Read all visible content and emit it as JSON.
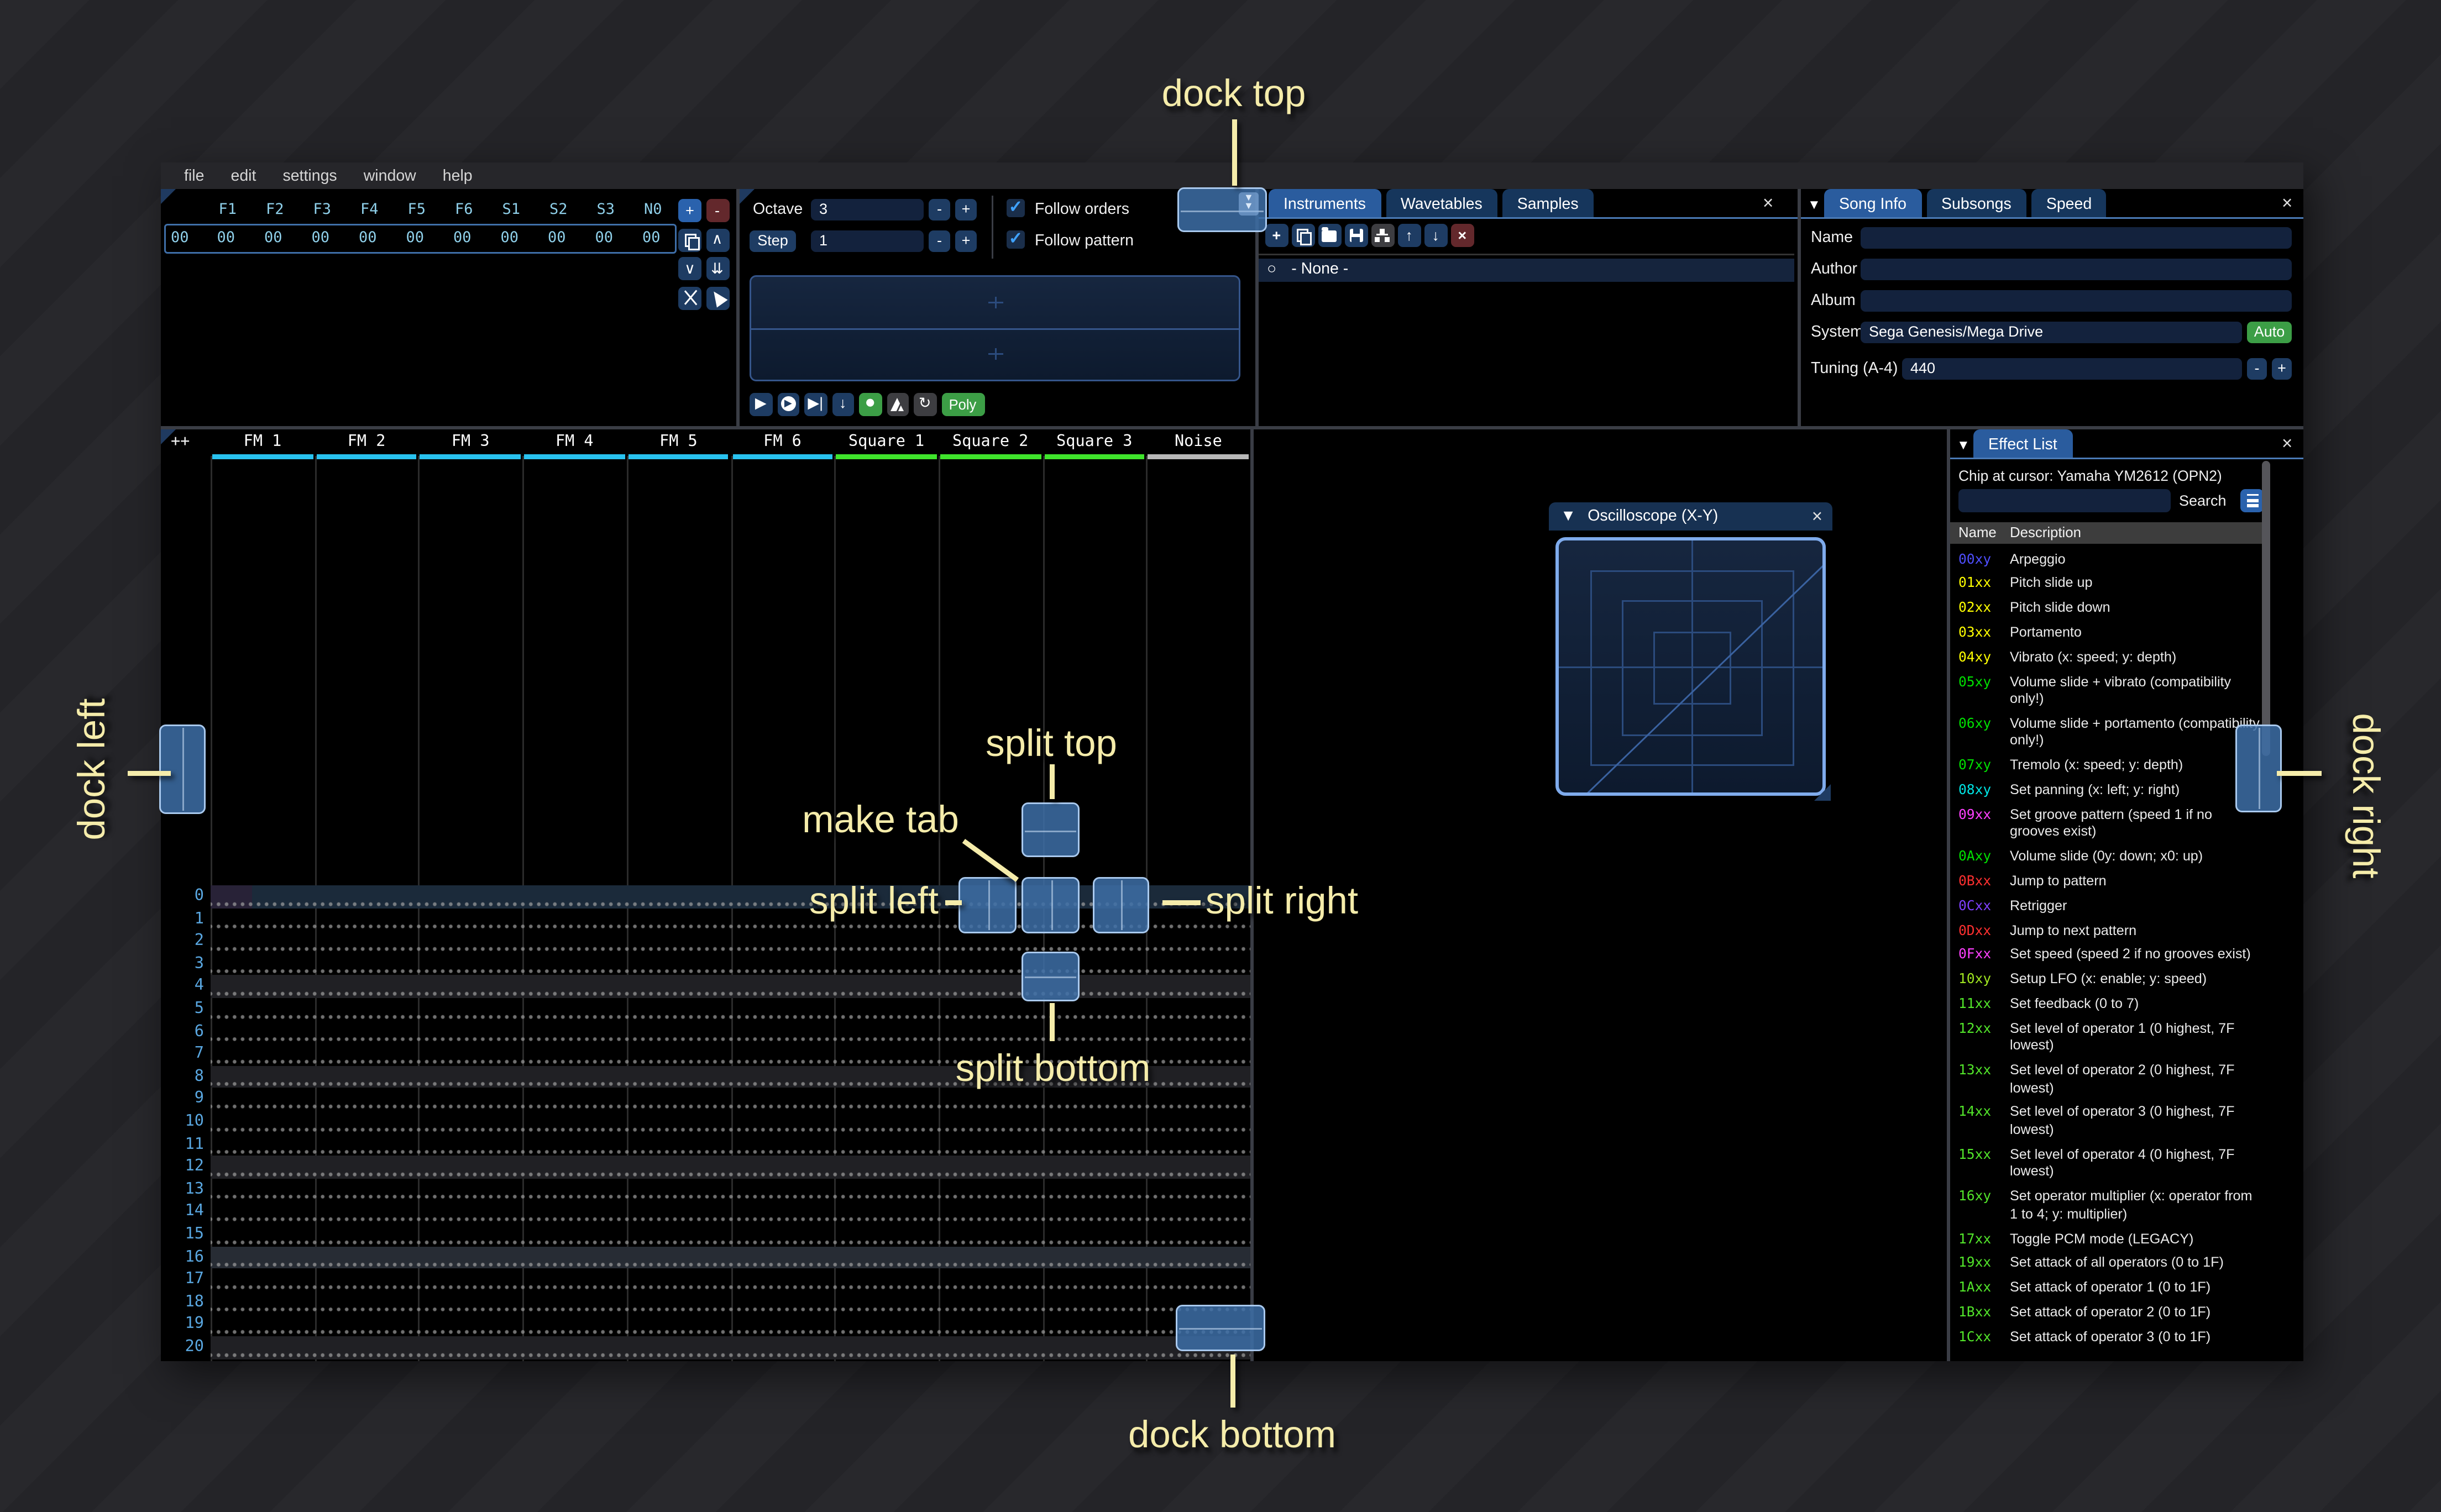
{
  "menu": {
    "items": [
      "file",
      "edit",
      "settings",
      "window",
      "help"
    ]
  },
  "orders": {
    "columns": [
      "F1",
      "F2",
      "F3",
      "F4",
      "F5",
      "F6",
      "S1",
      "S2",
      "S3",
      "N0"
    ],
    "row_index": "00",
    "row_values": [
      "00",
      "00",
      "00",
      "00",
      "00",
      "00",
      "00",
      "00",
      "00",
      "00"
    ],
    "buttons": [
      "add",
      "remove",
      "duplicate",
      "move-up",
      "move-down",
      "move-down-double",
      "deep-clone",
      "mouse-select"
    ]
  },
  "controls": {
    "octave_label": "Octave",
    "octave_value": "3",
    "step_label": "Step",
    "step_value": "1",
    "minus_label": "-",
    "plus_label": "+",
    "follow_orders_label": "Follow orders",
    "follow_pattern_label": "Follow pattern",
    "check_glyph": "✓"
  },
  "transport": {
    "buttons": [
      "play",
      "play-pattern",
      "play-from-cursor",
      "step-row",
      "record",
      "metronome",
      "repeat",
      "poly"
    ],
    "poly_label": "Poly"
  },
  "instruments": {
    "tabs": [
      "Instruments",
      "Wavetables",
      "Samples"
    ],
    "active_tab": "Instruments",
    "toolbar": [
      "add",
      "duplicate",
      "open",
      "save",
      "tree-view",
      "move-up",
      "move-down",
      "delete"
    ],
    "list": [
      {
        "selected": true,
        "label": "- None -"
      }
    ],
    "close_glyph": "×"
  },
  "song_info": {
    "tabs": [
      "Song Info",
      "Subsongs",
      "Speed"
    ],
    "active_tab": "Song Info",
    "fields": {
      "name_label": "Name",
      "name_value": "",
      "author_label": "Author",
      "author_value": "",
      "album_label": "Album",
      "album_value": "",
      "system_label": "System",
      "system_value": "Sega Genesis/Mega Drive",
      "auto_label": "Auto",
      "tuning_label": "Tuning (A-4)",
      "tuning_value": "440"
    }
  },
  "effect_list": {
    "tab": "Effect List",
    "chip_line": "Chip at cursor: Yamaha YM2612 (OPN2)",
    "search_label": "Search",
    "search_value": "",
    "columns": [
      "Name",
      "Description"
    ],
    "rows": [
      {
        "code": "00xy",
        "color": "#4f4fff",
        "desc": "Arpeggio"
      },
      {
        "code": "01xx",
        "color": "#ffff00",
        "desc": "Pitch slide up"
      },
      {
        "code": "02xx",
        "color": "#ffff00",
        "desc": "Pitch slide down"
      },
      {
        "code": "03xx",
        "color": "#ffff00",
        "desc": "Portamento"
      },
      {
        "code": "04xy",
        "color": "#ffff00",
        "desc": "Vibrato (x: speed; y: depth)"
      },
      {
        "code": "05xy",
        "color": "#00e000",
        "desc": "Volume slide + vibrato (compatibility only!)"
      },
      {
        "code": "06xy",
        "color": "#00e000",
        "desc": "Volume slide + portamento (compatibility only!)"
      },
      {
        "code": "07xy",
        "color": "#00e000",
        "desc": "Tremolo (x: speed; y: depth)"
      },
      {
        "code": "08xy",
        "color": "#00e5e5",
        "desc": "Set panning (x: left; y: right)"
      },
      {
        "code": "09xx",
        "color": "#ff40ff",
        "desc": "Set groove pattern (speed 1 if no grooves exist)"
      },
      {
        "code": "0Axy",
        "color": "#00e000",
        "desc": "Volume slide (0y: down; x0: up)"
      },
      {
        "code": "0Bxx",
        "color": "#ff3030",
        "desc": "Jump to pattern"
      },
      {
        "code": "0Cxx",
        "color": "#7f40ff",
        "desc": "Retrigger"
      },
      {
        "code": "0Dxx",
        "color": "#ff3030",
        "desc": "Jump to next pattern"
      },
      {
        "code": "0Fxx",
        "color": "#ff40ff",
        "desc": "Set speed (speed 2 if no grooves exist)"
      },
      {
        "code": "10xy",
        "color": "#9fe520",
        "desc": "Setup LFO (x: enable; y: speed)"
      },
      {
        "code": "11xx",
        "color": "#52e52a",
        "desc": "Set feedback (0 to 7)"
      },
      {
        "code": "12xx",
        "color": "#52e52a",
        "desc": "Set level of operator 1 (0 highest, 7F lowest)"
      },
      {
        "code": "13xx",
        "color": "#52e52a",
        "desc": "Set level of operator 2 (0 highest, 7F lowest)"
      },
      {
        "code": "14xx",
        "color": "#52e52a",
        "desc": "Set level of operator 3 (0 highest, 7F lowest)"
      },
      {
        "code": "15xx",
        "color": "#52e52a",
        "desc": "Set level of operator 4 (0 highest, 7F lowest)"
      },
      {
        "code": "16xy",
        "color": "#52e52a",
        "desc": "Set operator multiplier (x: operator from 1 to 4; y: multiplier)"
      },
      {
        "code": "17xx",
        "color": "#52e52a",
        "desc": "Toggle PCM mode (LEGACY)"
      },
      {
        "code": "19xx",
        "color": "#52e52a",
        "desc": "Set attack of all operators (0 to 1F)"
      },
      {
        "code": "1Axx",
        "color": "#52e52a",
        "desc": "Set attack of operator 1 (0 to 1F)"
      },
      {
        "code": "1Bxx",
        "color": "#52e52a",
        "desc": "Set attack of operator 2 (0 to 1F)"
      },
      {
        "code": "1Cxx",
        "color": "#52e52a",
        "desc": "Set attack of operator 3 (0 to 1F)"
      }
    ]
  },
  "oscilloscope": {
    "title": "Oscilloscope (X-Y)",
    "close_glyph": "×"
  },
  "pattern": {
    "expand_button": "++",
    "channels": [
      {
        "name": "FM 1",
        "color": "#29c2ef"
      },
      {
        "name": "FM 2",
        "color": "#29c2ef"
      },
      {
        "name": "FM 3",
        "color": "#29c2ef"
      },
      {
        "name": "FM 4",
        "color": "#29c2ef"
      },
      {
        "name": "FM 5",
        "color": "#29c2ef"
      },
      {
        "name": "FM 6",
        "color": "#29c2ef"
      },
      {
        "name": "Square 1",
        "color": "#3fe42c"
      },
      {
        "name": "Square 2",
        "color": "#3fe42c"
      },
      {
        "name": "Square 3",
        "color": "#3fe42c"
      },
      {
        "name": "Noise",
        "color": "#b8b8b8"
      }
    ],
    "visible_rows": 22,
    "current_row": 0,
    "highlight_minor": 4,
    "highlight_major": 16,
    "colors": {
      "current": "#1b2a3a",
      "minor": "#202024",
      "major": "#272c34"
    }
  },
  "dock_overlay": {
    "dock_top": "dock top",
    "dock_bottom": "dock bottom",
    "dock_left": "dock left",
    "dock_right": "dock right",
    "split_top": "split top",
    "split_bottom": "split bottom",
    "split_left": "split left",
    "split_right": "split right",
    "make_tab": "make tab",
    "accent": "#f5ecaa"
  }
}
